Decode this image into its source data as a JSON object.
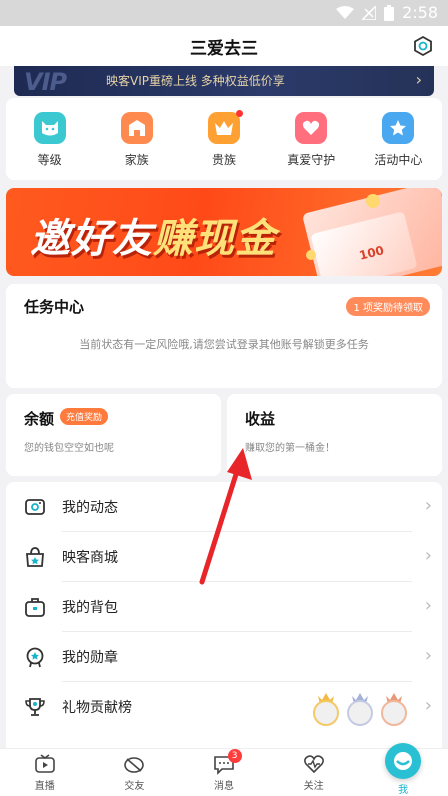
{
  "status": {
    "time": "2:58"
  },
  "header": {
    "title": "三爱去三"
  },
  "vip": {
    "logo": "VIP",
    "text": "映客VIP重磅上线 多种权益低价享"
  },
  "grid": [
    {
      "label": "等级",
      "color": "#3cc8d0",
      "icon": "cat-icon"
    },
    {
      "label": "家族",
      "color": "#ff8a50",
      "icon": "family-icon"
    },
    {
      "label": "贵族",
      "color": "#ffa033",
      "icon": "crown-icon"
    },
    {
      "label": "真爱守护",
      "color": "#ff6f7d",
      "icon": "heart-guard-icon"
    },
    {
      "label": "活动中心",
      "color": "#4aa8f0",
      "icon": "star-icon"
    }
  ],
  "banner": {
    "part1": "邀好友",
    "part2": "赚现金",
    "ticket_num": "100"
  },
  "task": {
    "title": "任务中心",
    "badge": "1 项奖励待领取",
    "message": "当前状态有一定风险哦,请您尝试登录其他账号解锁更多任务"
  },
  "balance": {
    "title": "余额",
    "badge": "充值奖励",
    "desc": "您的钱包空空如也呢"
  },
  "earnings": {
    "title": "收益",
    "desc": "赚取您的第一桶金！"
  },
  "menu": [
    {
      "label": "我的动态",
      "icon": "photo-icon"
    },
    {
      "label": "映客商城",
      "icon": "shop-icon"
    },
    {
      "label": "我的背包",
      "icon": "backpack-icon"
    },
    {
      "label": "我的勋章",
      "icon": "medal-icon"
    },
    {
      "label": "礼物贡献榜",
      "icon": "trophy-icon"
    }
  ],
  "tabs": [
    {
      "label": "直播",
      "icon": "live-icon"
    },
    {
      "label": "交友",
      "icon": "friends-icon"
    },
    {
      "label": "消息",
      "icon": "message-icon",
      "badge": "3"
    },
    {
      "label": "关注",
      "icon": "follow-icon"
    },
    {
      "label": "我",
      "icon": "me-icon"
    }
  ],
  "colors": {
    "accent": "#19b4c9",
    "arrow": "#e8262a"
  }
}
